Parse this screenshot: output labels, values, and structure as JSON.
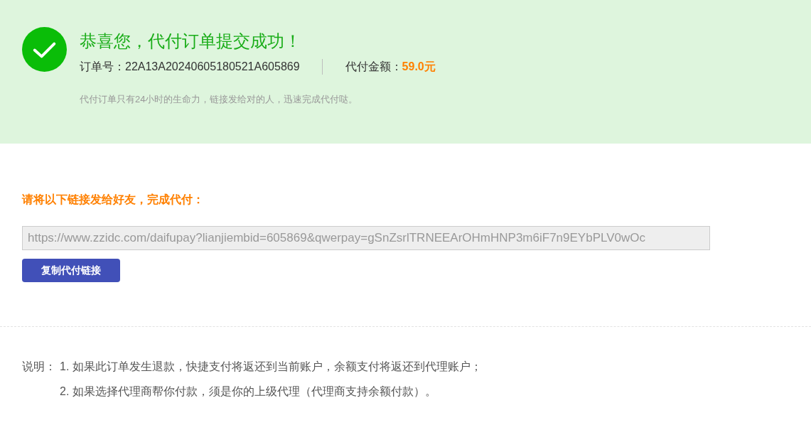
{
  "success_banner": {
    "title": "恭喜您，代付订单提交成功！",
    "order_label": "订单号：",
    "order_number": "22A13A20240605180521A605869",
    "amount_label": "代付金额：",
    "amount": "59.0元",
    "note": "代付订单只有24小时的生命力，链接发给对的人，迅速完成代付哒。"
  },
  "share": {
    "heading": "请将以下链接发给好友，完成代付：",
    "link": "https://www.zzidc.com/daifupay?lianjiembid=605869&qwerpay=gSnZsrlTRNEEArOHmHNP3m6iF7n9EYbPLV0wOc",
    "copy_button": "复制代付链接"
  },
  "notes": {
    "label": "说明：",
    "items": [
      "1. 如果此订单发生退款，快捷支付将返还到当前账户，余额支付将返还到代理账户；",
      "2. 如果选择代理商帮你付款，须是你的上级代理（代理商支持余额付款）。"
    ]
  }
}
